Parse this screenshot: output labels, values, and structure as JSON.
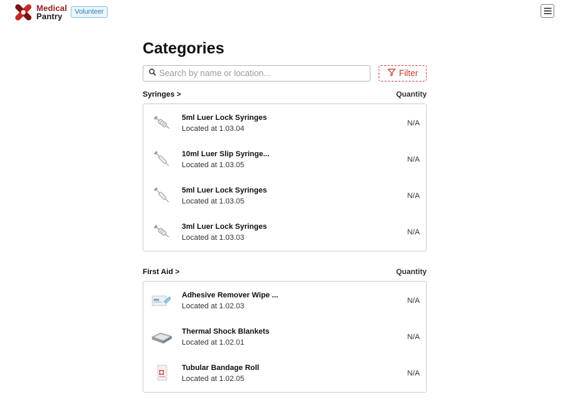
{
  "header": {
    "logo_line1": "Medical",
    "logo_line2": "Pantry",
    "role_badge": "Volunteer"
  },
  "main": {
    "title": "Categories",
    "search_placeholder": "Search by name or location...",
    "filter_label": "Filter",
    "categories": [
      {
        "name": "Syringes >",
        "quantity_header": "Quantity",
        "items": [
          {
            "name": "5ml Luer Lock Syringes",
            "location": "Located at 1.03.04",
            "quantity": "N/A",
            "icon": "syringe-icon"
          },
          {
            "name": "10ml Luer Slip Syringe...",
            "location": "Located at 1.03.05",
            "quantity": "N/A",
            "icon": "syringe-icon"
          },
          {
            "name": "5ml Luer Lock Syringes",
            "location": "Located at 1.03.05",
            "quantity": "N/A",
            "icon": "syringe-icon"
          },
          {
            "name": "3ml Luer Lock Syringes",
            "location": "Located at 1.03.03",
            "quantity": "N/A",
            "icon": "syringe-icon"
          }
        ]
      },
      {
        "name": "First Aid >",
        "quantity_header": "Quantity",
        "items": [
          {
            "name": "Adhesive Remover Wipe ...",
            "location": "Located at 1.02.03",
            "quantity": "N/A",
            "icon": "wipe-packet-icon"
          },
          {
            "name": "Thermal Shock Blankets",
            "location": "Located at 1.02.01",
            "quantity": "N/A",
            "icon": "blanket-icon"
          },
          {
            "name": "Tubular Bandage Roll",
            "location": "Located at 1.02.05",
            "quantity": "N/A",
            "icon": "bandage-box-icon"
          }
        ]
      }
    ]
  },
  "colors": {
    "brand_red": "#8e1c1c",
    "logo_red": "#c62828",
    "filter_red": "#c0392b",
    "badge_blue": "#2a7ab8"
  }
}
